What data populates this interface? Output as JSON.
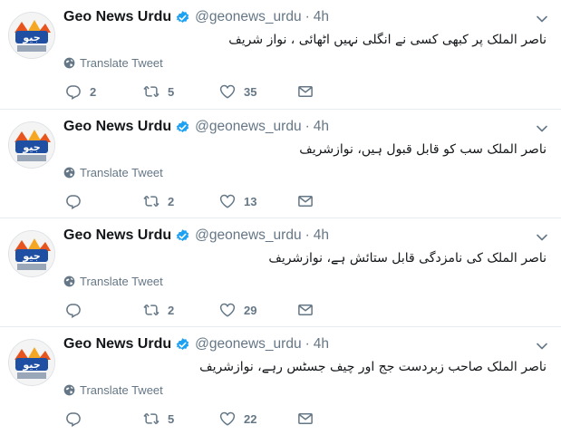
{
  "colors": {
    "text": "#14171a",
    "muted": "#657786",
    "verified": "#1da1f2",
    "divider": "#e6ecf0"
  },
  "tweets": [
    {
      "name": "Geo News Urdu",
      "handle": "@geonews_urdu",
      "separator": "·",
      "time": "4h",
      "text": "ناصر الملک پر کبھی کسی نے انگلی نہیں اٹھائی ، نواز شریف",
      "translate": "Translate Tweet",
      "replies": "2",
      "retweets": "5",
      "likes": "35"
    },
    {
      "name": "Geo News Urdu",
      "handle": "@geonews_urdu",
      "separator": "·",
      "time": "4h",
      "text": "ناصر الملک سب کو قابل قبول ہیں، نوازشریف",
      "translate": "Translate Tweet",
      "replies": "",
      "retweets": "2",
      "likes": "13"
    },
    {
      "name": "Geo News Urdu",
      "handle": "@geonews_urdu",
      "separator": "·",
      "time": "4h",
      "text": "ناصر الملک کی نامزدگی قابل ستائش ہے، نوازشریف",
      "translate": "Translate Tweet",
      "replies": "",
      "retweets": "2",
      "likes": "29"
    },
    {
      "name": "Geo News Urdu",
      "handle": "@geonews_urdu",
      "separator": "·",
      "time": "4h",
      "text": "ناصر الملک صاحب زبردست جج اور چیف جسٹس رہے، نوازشریف",
      "translate": "Translate Tweet",
      "replies": "",
      "retweets": "5",
      "likes": "22"
    }
  ]
}
